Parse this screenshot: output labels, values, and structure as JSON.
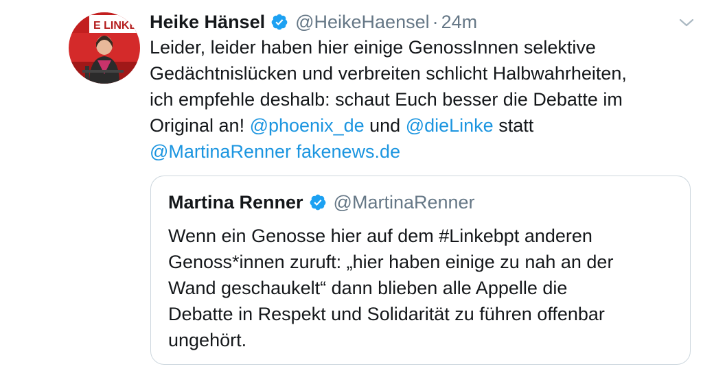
{
  "tweet": {
    "display_name": "Heike Hänsel",
    "handle": "@HeikeHaensel",
    "separator": "·",
    "time": "24m",
    "verified": true,
    "avatar_banner_text": "E LINKE.",
    "body_lines": [
      [
        {
          "text": "Leider, leider haben hier einige GenossInnen selektive"
        }
      ],
      [
        {
          "text": "Gedächtnislücken und verbreiten schlicht Halbwahrheiten,"
        }
      ],
      [
        {
          "text": "ich empfehle deshalb: schaut Euch besser die Debatte im"
        }
      ],
      [
        {
          "text": "Original an! "
        },
        {
          "text": "@phoenix_de",
          "link": true
        },
        {
          "text": " und "
        },
        {
          "text": "@dieLinke",
          "link": true
        },
        {
          "text": " statt"
        }
      ],
      [
        {
          "text": "@MartinaRenner fakenews.de",
          "link": true
        }
      ]
    ]
  },
  "quoted_tweet": {
    "display_name": "Martina Renner",
    "handle": "@MartinaRenner",
    "verified": true,
    "body_lines": [
      "Wenn ein Genosse hier auf dem #Linkebpt anderen",
      "Genoss*innen zuruft: „hier haben einige zu nah an der",
      "Wand geschaukelt“ dann blieben alle Appelle die",
      "Debatte in Respekt und Solidarität zu führen offenbar",
      "ungehört."
    ]
  },
  "colors": {
    "link": "#1b95e0",
    "verified": "#1da1f2",
    "secondary_text": "#657786",
    "border": "#ccd6dd",
    "avatar_bg": "#d42a2a"
  },
  "icons": {
    "verified": "verified-badge-icon",
    "caret": "chevron-down-icon"
  }
}
